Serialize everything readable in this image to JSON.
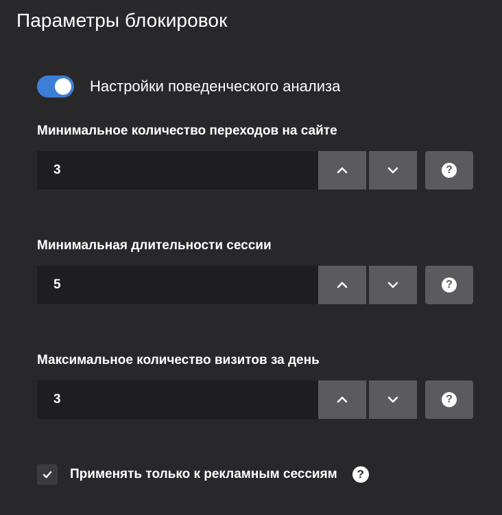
{
  "title": "Параметры блокировок",
  "behavior_toggle": {
    "label": "Настройки поведенческого анализа",
    "checked": true,
    "color": "#3d7ed6"
  },
  "fields": [
    {
      "label": "Минимальное количество переходов на сайте",
      "value": "3",
      "up_icon": "chevron-up-icon",
      "down_icon": "chevron-down-icon",
      "help_glyph": "?"
    },
    {
      "label": "Минимальная длительности сессии",
      "value": "5",
      "up_icon": "chevron-up-icon",
      "down_icon": "chevron-down-icon",
      "help_glyph": "?"
    },
    {
      "label": "Максимальное количество визитов за день",
      "value": "3",
      "up_icon": "chevron-up-icon",
      "down_icon": "chevron-down-icon",
      "help_glyph": "?"
    }
  ],
  "ads_only": {
    "label": "Применять только к рекламным сессиям",
    "checked": true,
    "help_glyph": "?"
  },
  "colors": {
    "background": "#28282b",
    "input_background": "#1e1e21",
    "button_background": "#5b5b5f",
    "accent": "#3d7ed6"
  }
}
